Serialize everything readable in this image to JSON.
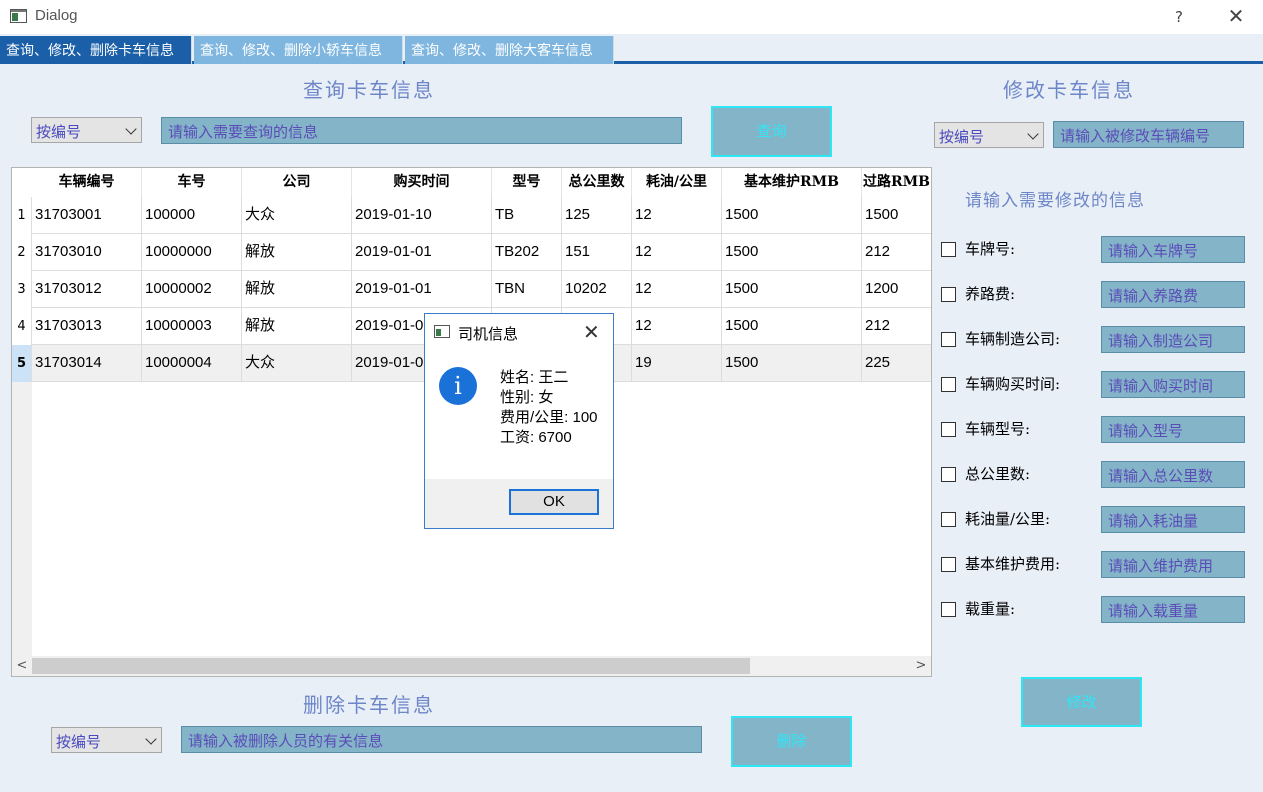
{
  "window": {
    "title": "Dialog",
    "help_glyph": "?",
    "close_glyph": "✕"
  },
  "tabs": [
    {
      "label": "查询、修改、删除卡车信息"
    },
    {
      "label": "查询、修改、删除小轿车信息"
    },
    {
      "label": "查询、修改、删除大客车信息"
    }
  ],
  "query": {
    "title": "查询卡车信息",
    "mode": "按编号",
    "placeholder": "请输入需要查询的信息",
    "button": "查询"
  },
  "table": {
    "columns": [
      "车辆编号",
      "车号",
      "公司",
      "购买时间",
      "型号",
      "总公里数",
      "耗油/公里",
      "基本维护RMB",
      "过路RMB"
    ],
    "rows": [
      {
        "num": "1",
        "cells": [
          "31703001",
          "100000",
          "大众",
          "2019-01-10",
          "TB",
          "125",
          "12",
          "1500",
          "1500"
        ]
      },
      {
        "num": "2",
        "cells": [
          "31703010",
          "10000000",
          "解放",
          "2019-01-01",
          "TB202",
          "151",
          "12",
          "1500",
          "212"
        ]
      },
      {
        "num": "3",
        "cells": [
          "31703012",
          "10000002",
          "解放",
          "2019-01-01",
          "TBN",
          "10202",
          "12",
          "1500",
          "1200"
        ]
      },
      {
        "num": "4",
        "cells": [
          "31703013",
          "10000003",
          "解放",
          "2019-01-0",
          "",
          "",
          "12",
          "1500",
          "212"
        ]
      },
      {
        "num": "5",
        "cells": [
          "31703014",
          "10000004",
          "大众",
          "2019-01-0",
          "",
          "",
          "19",
          "1500",
          "225"
        ]
      }
    ],
    "scroll_left": "<",
    "scroll_right": ">"
  },
  "modify": {
    "title": "修改卡车信息",
    "mode": "按编号",
    "placeholder": "请输入被修改车辆编号",
    "subtitle": "请输入需要修改的信息",
    "fields": [
      {
        "label": "车牌号:",
        "placeholder": "请输入车牌号"
      },
      {
        "label": "养路费:",
        "placeholder": "请输入养路费"
      },
      {
        "label": "车辆制造公司:",
        "placeholder": "请输入制造公司"
      },
      {
        "label": "车辆购买时间:",
        "placeholder": "请输入购买时间"
      },
      {
        "label": "车辆型号:",
        "placeholder": "请输入型号"
      },
      {
        "label": "总公里数:",
        "placeholder": "请输入总公里数"
      },
      {
        "label": "耗油量/公里:",
        "placeholder": "请输入耗油量"
      },
      {
        "label": "基本维护费用:",
        "placeholder": "请输入维护费用"
      },
      {
        "label": "载重量:",
        "placeholder": "请输入载重量"
      }
    ],
    "button": "修改"
  },
  "delete": {
    "title": "删除卡车信息",
    "mode": "按编号",
    "placeholder": "请输入被删除人员的有关信息",
    "button": "删除"
  },
  "message_box": {
    "title": "司机信息",
    "close_glyph": "✕",
    "icon_glyph": "i",
    "lines": [
      "姓名: 王二",
      "性别: 女",
      "费用/公里: 100",
      "工资: 6700"
    ],
    "ok": "OK"
  }
}
